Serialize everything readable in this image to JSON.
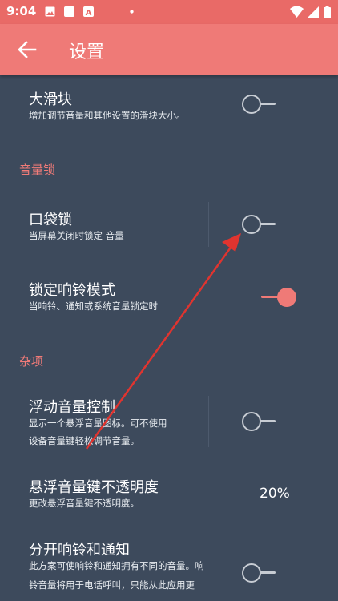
{
  "status_bar": {
    "time": "9:04"
  },
  "app_bar": {
    "title": "设置"
  },
  "settings": [
    {
      "title": "大滑块",
      "desc": "增加调节音量和其他设置的滑块大小。",
      "switch_on": false
    },
    {
      "title": "口袋锁",
      "desc": "当屏幕关闭时锁定 音量",
      "switch_on": false
    },
    {
      "title": "锁定响铃模式",
      "desc": "当响铃、通知或系统音量锁定时",
      "switch_on": true
    },
    {
      "title": "浮动音量控制",
      "desc1": "显示一个悬浮音量图标。可不使用",
      "desc2": "设备音量键轻松调节音量。",
      "switch_on": false
    },
    {
      "title": "悬浮音量键不透明度",
      "desc": "更改悬浮音量键不透明度。",
      "value": "20%"
    },
    {
      "title": "分开响铃和通知",
      "desc1": "此方案可使响铃和通知拥有不同的音量。响",
      "desc2": "铃音量将用于电话呼叫，只能从此应用更",
      "switch_on": false
    }
  ],
  "sections": {
    "volume_lock": "音量锁",
    "misc": "杂项"
  },
  "colors": {
    "accent": "#ef7a77",
    "background": "#3d4a5c",
    "status_bar": "#e96a67"
  },
  "icons": [
    "image-icon",
    "square-icon",
    "a-icon",
    "dot-icon",
    "wifi-icon",
    "signal-icon",
    "battery-icon",
    "back-arrow-icon"
  ]
}
